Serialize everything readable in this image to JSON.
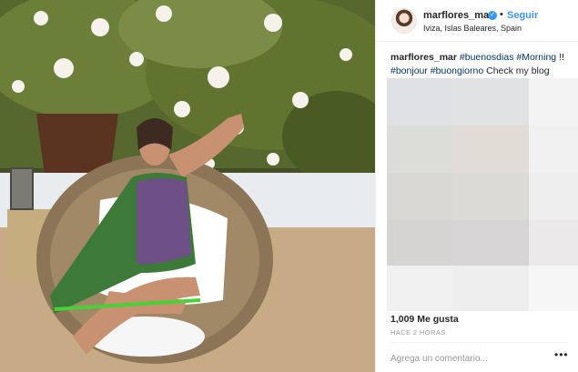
{
  "post": {
    "username": "marflores_mar",
    "follow_label": "Seguir",
    "dot": "•",
    "location": "Iviza, Islas Baleares, Spain",
    "caption_user": "marflores_mar",
    "caption_parts": [
      {
        "text": " "
      },
      {
        "text": "#buenosdias",
        "tag": true
      },
      {
        "text": " "
      },
      {
        "text": "#Morning",
        "tag": true
      },
      {
        "text": " !! "
      },
      {
        "text": "#bonjour",
        "tag": true
      },
      {
        "text": " "
      },
      {
        "text": "#buongiorno",
        "tag": true
      },
      {
        "text": " Check my blog"
      }
    ],
    "likes": "1,009 Me gusta",
    "time": "HACE 2 HORAS",
    "comment_placeholder": "Agrega un comentario...",
    "more_label": "•••"
  },
  "colors": {
    "accent": "#3897f0",
    "hashtag": "#003569",
    "muted": "#999999"
  },
  "blur_tiles": [
    "#dfe1e4",
    "#e1e2e3",
    "#f3f3f3",
    "#dcdcd8",
    "#e1ddd6",
    "#f0f0f0",
    "#dad8d5",
    "#dcdad7",
    "#eeeeee",
    "#d6d4d2",
    "#d6d4d4",
    "#ebe9ea",
    "#f0f0f0",
    "#eeeeee",
    "#f6f6f6"
  ],
  "icons": {
    "verified": "verified-badge-icon",
    "more": "more-options-icon"
  }
}
